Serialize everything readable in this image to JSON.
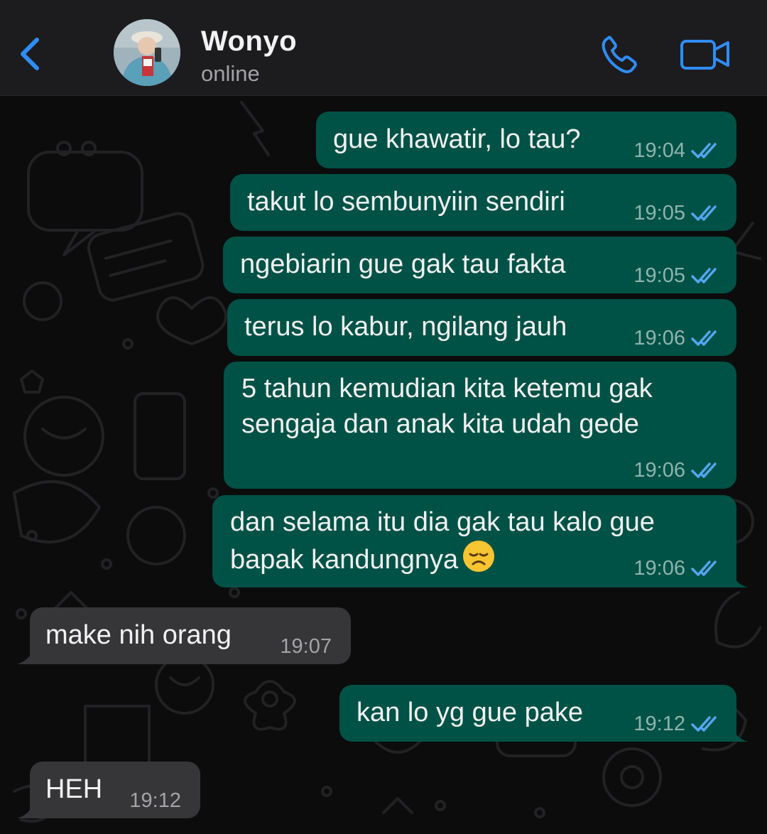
{
  "header": {
    "contact_name": "Wonyo",
    "contact_status": "online",
    "back_icon": "chevron-left-icon",
    "call_icon": "phone-icon",
    "video_icon": "video-camera-icon",
    "accent_color": "#2f8cf7"
  },
  "colors": {
    "outgoing_bubble": "#005246",
    "incoming_bubble": "#363638",
    "read_ticks": "#53a6f0"
  },
  "messages": [
    {
      "direction": "outgoing",
      "text": "gue khawatir, lo tau?",
      "time": "19:04",
      "status": "read"
    },
    {
      "direction": "outgoing",
      "text": "takut lo sembunyiin sendiri",
      "time": "19:05",
      "status": "read"
    },
    {
      "direction": "outgoing",
      "text": "ngebiarin gue gak tau fakta",
      "time": "19:05",
      "status": "read"
    },
    {
      "direction": "outgoing",
      "text": "terus lo kabur, ngilang jauh",
      "time": "19:06",
      "status": "read"
    },
    {
      "direction": "outgoing",
      "lines": [
        "5 tahun kemudian kita ketemu gak",
        "sengaja dan anak kita udah gede"
      ],
      "time": "19:06",
      "status": "read"
    },
    {
      "direction": "outgoing",
      "lines": [
        "dan selama itu dia gak tau kalo gue",
        "bapak kandungnya"
      ],
      "emoji": "disappointed-face",
      "time": "19:06",
      "status": "read"
    },
    {
      "direction": "incoming",
      "text": "make nih orang",
      "time": "19:07"
    },
    {
      "direction": "outgoing",
      "text": "kan lo yg gue pake",
      "time": "19:12",
      "status": "read"
    },
    {
      "direction": "incoming",
      "text": "HEH",
      "time": "19:12"
    }
  ]
}
